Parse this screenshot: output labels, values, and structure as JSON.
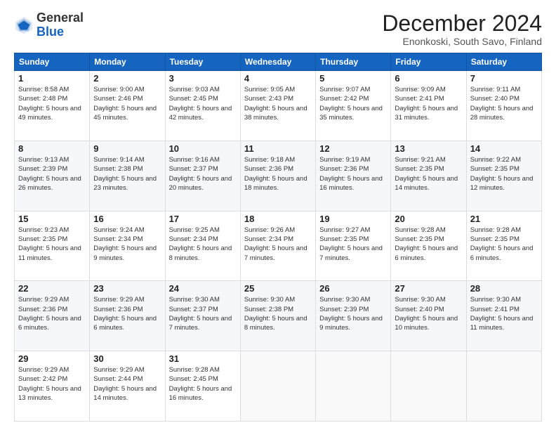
{
  "logo": {
    "general": "General",
    "blue": "Blue"
  },
  "header": {
    "month": "December 2024",
    "location": "Enonkoski, South Savo, Finland"
  },
  "days_of_week": [
    "Sunday",
    "Monday",
    "Tuesday",
    "Wednesday",
    "Thursday",
    "Friday",
    "Saturday"
  ],
  "weeks": [
    [
      {
        "day": "1",
        "sunrise": "8:58 AM",
        "sunset": "2:48 PM",
        "daylight": "5 hours and 49 minutes."
      },
      {
        "day": "2",
        "sunrise": "9:00 AM",
        "sunset": "2:46 PM",
        "daylight": "5 hours and 45 minutes."
      },
      {
        "day": "3",
        "sunrise": "9:03 AM",
        "sunset": "2:45 PM",
        "daylight": "5 hours and 42 minutes."
      },
      {
        "day": "4",
        "sunrise": "9:05 AM",
        "sunset": "2:43 PM",
        "daylight": "5 hours and 38 minutes."
      },
      {
        "day": "5",
        "sunrise": "9:07 AM",
        "sunset": "2:42 PM",
        "daylight": "5 hours and 35 minutes."
      },
      {
        "day": "6",
        "sunrise": "9:09 AM",
        "sunset": "2:41 PM",
        "daylight": "5 hours and 31 minutes."
      },
      {
        "day": "7",
        "sunrise": "9:11 AM",
        "sunset": "2:40 PM",
        "daylight": "5 hours and 28 minutes."
      }
    ],
    [
      {
        "day": "8",
        "sunrise": "9:13 AM",
        "sunset": "2:39 PM",
        "daylight": "5 hours and 26 minutes."
      },
      {
        "day": "9",
        "sunrise": "9:14 AM",
        "sunset": "2:38 PM",
        "daylight": "5 hours and 23 minutes."
      },
      {
        "day": "10",
        "sunrise": "9:16 AM",
        "sunset": "2:37 PM",
        "daylight": "5 hours and 20 minutes."
      },
      {
        "day": "11",
        "sunrise": "9:18 AM",
        "sunset": "2:36 PM",
        "daylight": "5 hours and 18 minutes."
      },
      {
        "day": "12",
        "sunrise": "9:19 AM",
        "sunset": "2:36 PM",
        "daylight": "5 hours and 16 minutes."
      },
      {
        "day": "13",
        "sunrise": "9:21 AM",
        "sunset": "2:35 PM",
        "daylight": "5 hours and 14 minutes."
      },
      {
        "day": "14",
        "sunrise": "9:22 AM",
        "sunset": "2:35 PM",
        "daylight": "5 hours and 12 minutes."
      }
    ],
    [
      {
        "day": "15",
        "sunrise": "9:23 AM",
        "sunset": "2:35 PM",
        "daylight": "5 hours and 11 minutes."
      },
      {
        "day": "16",
        "sunrise": "9:24 AM",
        "sunset": "2:34 PM",
        "daylight": "5 hours and 9 minutes."
      },
      {
        "day": "17",
        "sunrise": "9:25 AM",
        "sunset": "2:34 PM",
        "daylight": "5 hours and 8 minutes."
      },
      {
        "day": "18",
        "sunrise": "9:26 AM",
        "sunset": "2:34 PM",
        "daylight": "5 hours and 7 minutes."
      },
      {
        "day": "19",
        "sunrise": "9:27 AM",
        "sunset": "2:35 PM",
        "daylight": "5 hours and 7 minutes."
      },
      {
        "day": "20",
        "sunrise": "9:28 AM",
        "sunset": "2:35 PM",
        "daylight": "5 hours and 6 minutes."
      },
      {
        "day": "21",
        "sunrise": "9:28 AM",
        "sunset": "2:35 PM",
        "daylight": "5 hours and 6 minutes."
      }
    ],
    [
      {
        "day": "22",
        "sunrise": "9:29 AM",
        "sunset": "2:36 PM",
        "daylight": "5 hours and 6 minutes."
      },
      {
        "day": "23",
        "sunrise": "9:29 AM",
        "sunset": "2:36 PM",
        "daylight": "5 hours and 6 minutes."
      },
      {
        "day": "24",
        "sunrise": "9:30 AM",
        "sunset": "2:37 PM",
        "daylight": "5 hours and 7 minutes."
      },
      {
        "day": "25",
        "sunrise": "9:30 AM",
        "sunset": "2:38 PM",
        "daylight": "5 hours and 8 minutes."
      },
      {
        "day": "26",
        "sunrise": "9:30 AM",
        "sunset": "2:39 PM",
        "daylight": "5 hours and 9 minutes."
      },
      {
        "day": "27",
        "sunrise": "9:30 AM",
        "sunset": "2:40 PM",
        "daylight": "5 hours and 10 minutes."
      },
      {
        "day": "28",
        "sunrise": "9:30 AM",
        "sunset": "2:41 PM",
        "daylight": "5 hours and 11 minutes."
      }
    ],
    [
      {
        "day": "29",
        "sunrise": "9:29 AM",
        "sunset": "2:42 PM",
        "daylight": "5 hours and 13 minutes."
      },
      {
        "day": "30",
        "sunrise": "9:29 AM",
        "sunset": "2:44 PM",
        "daylight": "5 hours and 14 minutes."
      },
      {
        "day": "31",
        "sunrise": "9:28 AM",
        "sunset": "2:45 PM",
        "daylight": "5 hours and 16 minutes."
      },
      null,
      null,
      null,
      null
    ]
  ]
}
